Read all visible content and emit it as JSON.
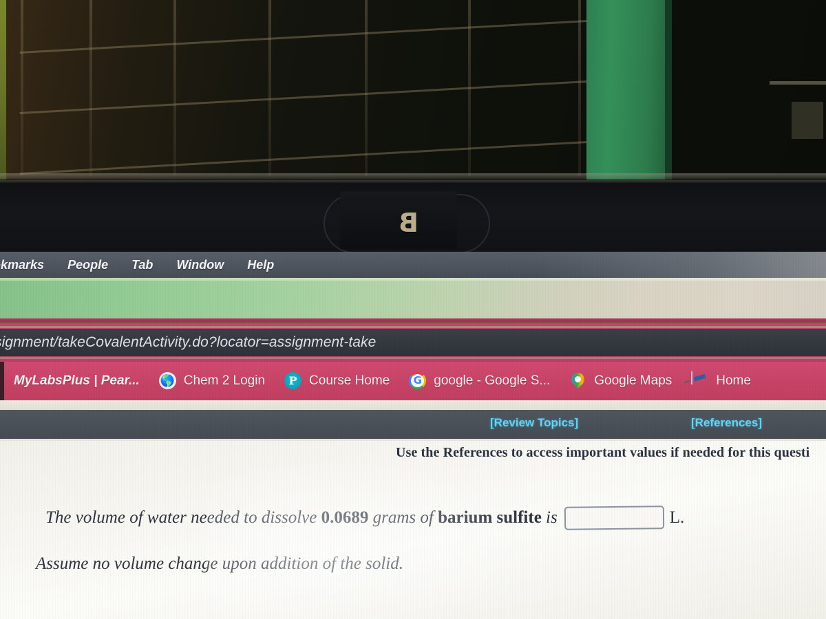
{
  "photo": {
    "description": "dark-room-window-grid-with-green-wall-panel",
    "laptop_logo": "B"
  },
  "menubar": {
    "items": [
      {
        "label": "okmarks",
        "name": "menu-bookmarks-clipped"
      },
      {
        "label": "People",
        "name": "menu-people"
      },
      {
        "label": "Tab",
        "name": "menu-tab"
      },
      {
        "label": "Window",
        "name": "menu-window"
      },
      {
        "label": "Help",
        "name": "menu-help"
      }
    ]
  },
  "omnibox": {
    "url": "signment/takeCovalentActivity.do?locator=assignment-take"
  },
  "bookmarks": {
    "items": [
      {
        "label": "MyLabsPlus | Pear...",
        "icon": "none",
        "name": "bookmark-mylabsplus"
      },
      {
        "label": "Chem 2 Login",
        "icon": "globe-icon",
        "name": "bookmark-chem-2-login"
      },
      {
        "label": "Course Home",
        "icon": "pearson-p-icon",
        "name": "bookmark-course-home"
      },
      {
        "label": "google - Google S...",
        "icon": "google-g-icon",
        "name": "bookmark-google-search"
      },
      {
        "label": "Google Maps",
        "icon": "map-pin-icon",
        "name": "bookmark-google-maps"
      },
      {
        "label": "Home",
        "icon": "note-pencil-icon",
        "name": "bookmark-home"
      }
    ]
  },
  "toolbar_links": {
    "review_topics": "[Review Topics]",
    "references": "[References]"
  },
  "question": {
    "instruction": "Use the References to access important values if needed for this questi",
    "line1_part1": "The volume of water needed to dissolve",
    "line1_mass": "0.0689",
    "line1_part2": "grams of",
    "line1_compound": "barium sulfite",
    "line1_part3": "is",
    "answer_value": "",
    "answer_unit": "L.",
    "line2": "Assume no volume change upon addition of the solid."
  },
  "colors": {
    "bookmark_bar": "#c94467",
    "omnibox_bg": "#34383f",
    "menubar_bg": "#4e555f",
    "link_cyan": "#63d6f5",
    "tabstrip_green": "#92cb93",
    "page_bg": "#f7f6f1"
  }
}
